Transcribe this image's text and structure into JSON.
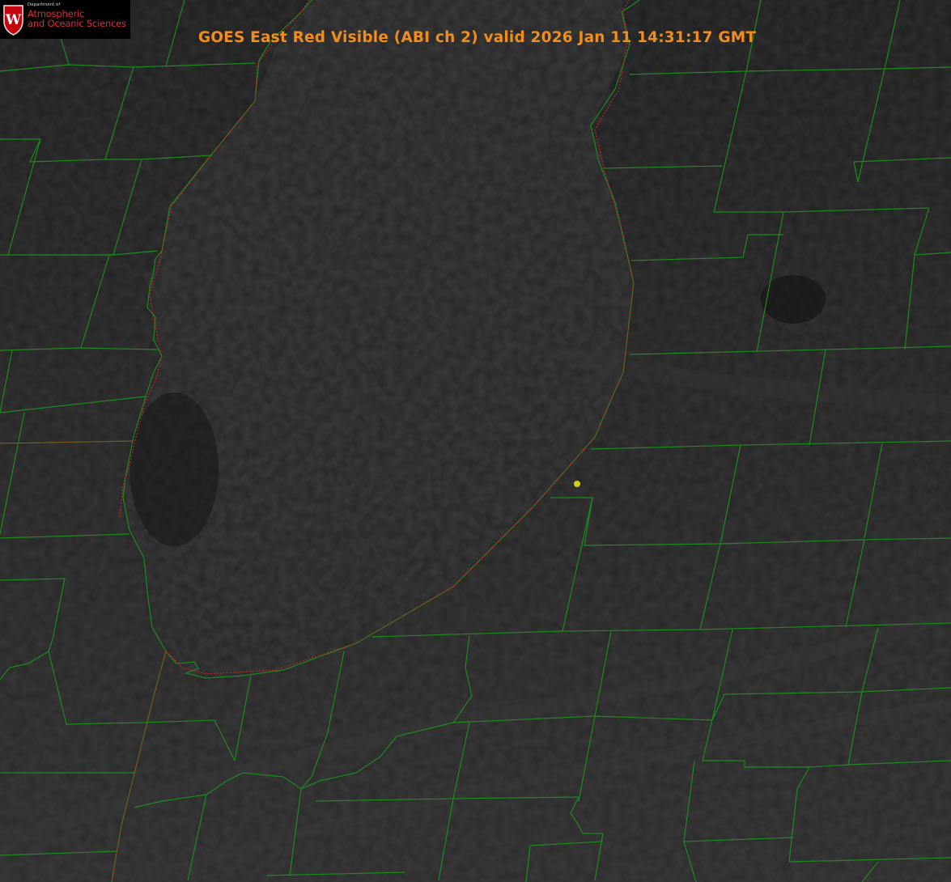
{
  "logo": {
    "department": "Department of",
    "line1": "Atmospheric",
    "line2": "and Oceanic Sciences",
    "shield_letter": "W"
  },
  "image_title": "GOES East Red Visible (ABI ch 2) valid 2026 Jan 11 14:31:17 GMT",
  "colors": {
    "background": "#1e1e1e",
    "lake": "#262626",
    "county_lines": "#1c8a1c",
    "shoreline_dotted": "#d02222",
    "title": "#f28c1b",
    "site_marker": "#d6cc1c",
    "logo_red": "#e02a33",
    "logo_shield": "#c5050c"
  }
}
